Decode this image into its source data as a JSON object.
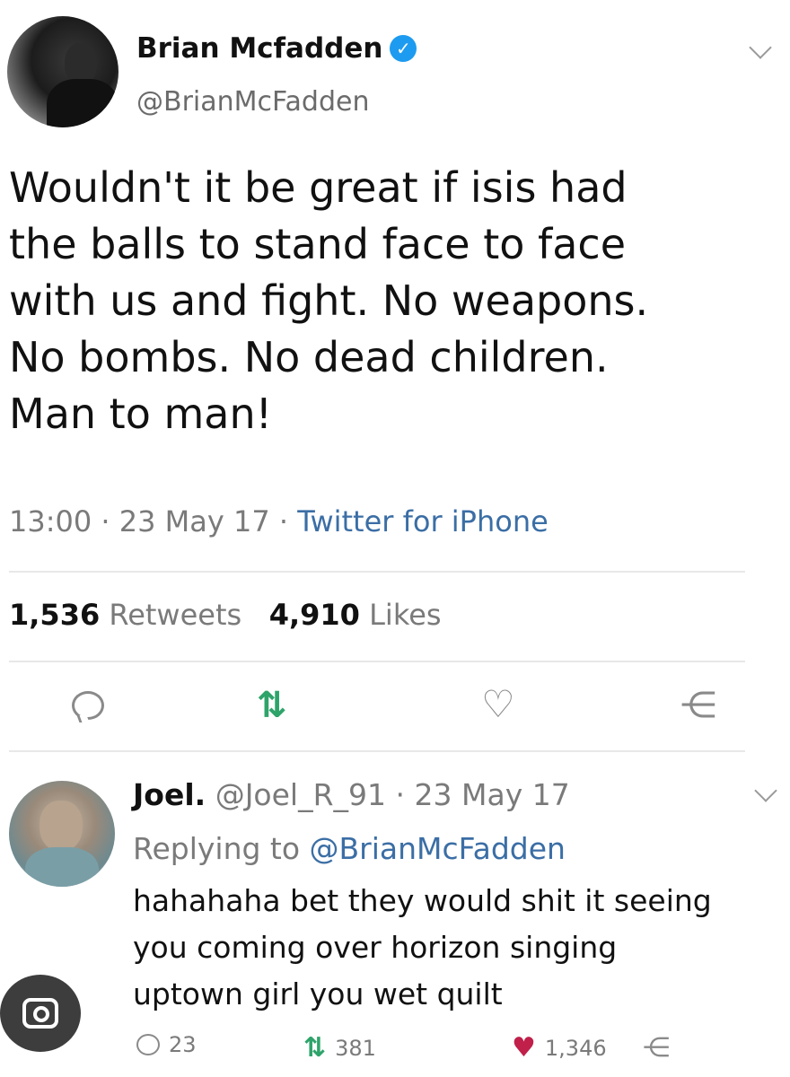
{
  "main_tweet": {
    "author_name": "Brian Mcfadden",
    "handle": "@BrianMcFadden",
    "text_lines": [
      "Wouldn't it be great if isis had",
      "the balls to stand face to face",
      "with us and fight. No weapons.",
      "No bombs. No dead children.",
      "Man to man!"
    ],
    "time": "13:00",
    "date": "23 May 17",
    "source": "Twitter for iPhone",
    "retweets_count": "1,536",
    "retweets_label": "Retweets",
    "likes_count": "4,910",
    "likes_label": "Likes",
    "icons": [
      "reply-icon",
      "retweet-icon",
      "like-icon",
      "share-icon"
    ]
  },
  "reply_tweet": {
    "author_name": "Joel.",
    "handle": "@Joel_R_91",
    "date": "23 May 17",
    "replying_label": "Replying to",
    "replying_to": "@BrianMcFadden",
    "text_lines": [
      "hahahaha bet they would shit it seeing",
      "you coming over horizon singing",
      "uptown girl you wet quilt"
    ],
    "reply_count": "23",
    "retweet_count": "381",
    "like_count": "1,346"
  },
  "colors": {
    "link": "#3b6ea5",
    "retweet_green": "#2ea36a",
    "like_red": "#c0204a",
    "verified_blue": "#1d9bf0"
  }
}
